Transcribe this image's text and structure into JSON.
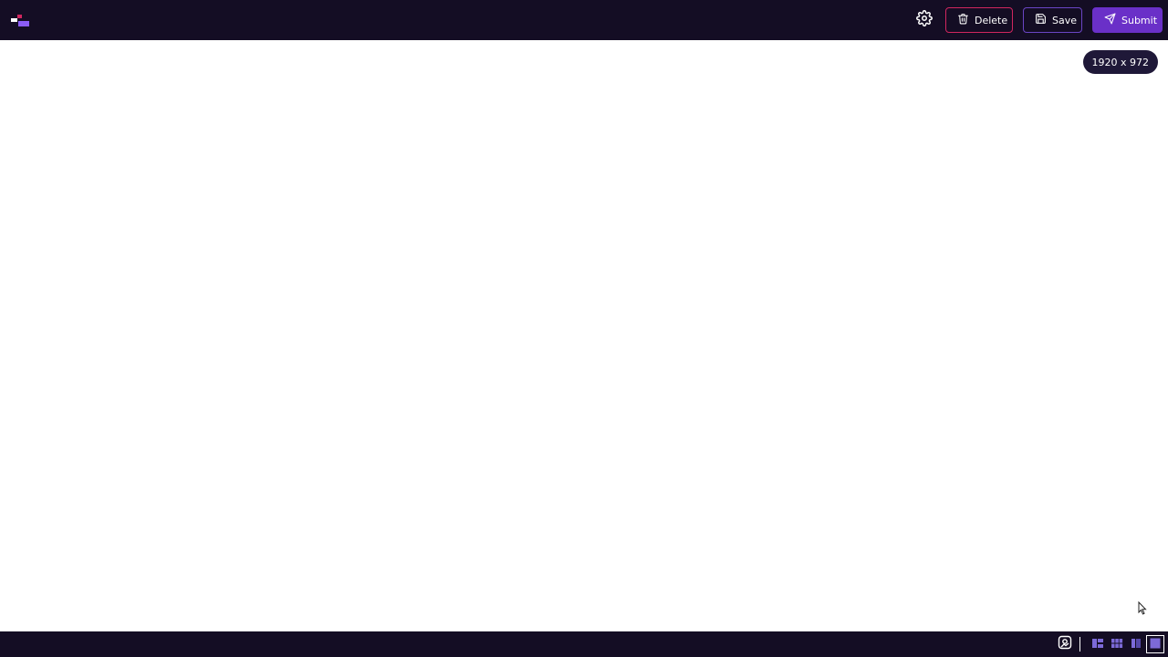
{
  "toolbar": {
    "delete_label": "Delete",
    "save_label": "Save",
    "submit_label": "Submit"
  },
  "canvas": {
    "size_label": "1920 x 972"
  },
  "icons": {
    "logo": "app-logo",
    "settings": "gear-icon",
    "delete": "trash-icon",
    "save": "floppy-disk-icon",
    "submit": "send-plane-icon",
    "screenshot": "screenshot-icon",
    "layout_1": "layout-split-icon",
    "layout_2": "layout-grid-icon",
    "layout_3": "layout-sidebar-icon",
    "layout_4": "layout-full-icon"
  },
  "colors": {
    "bar_background": "#140d24",
    "delete_accent": "#d0265f",
    "save_accent": "#6a45c4",
    "submit_accent": "#6a30c8",
    "badge_background": "#1f1838"
  },
  "bottom_bar": {
    "active_layout": "layout-full"
  }
}
